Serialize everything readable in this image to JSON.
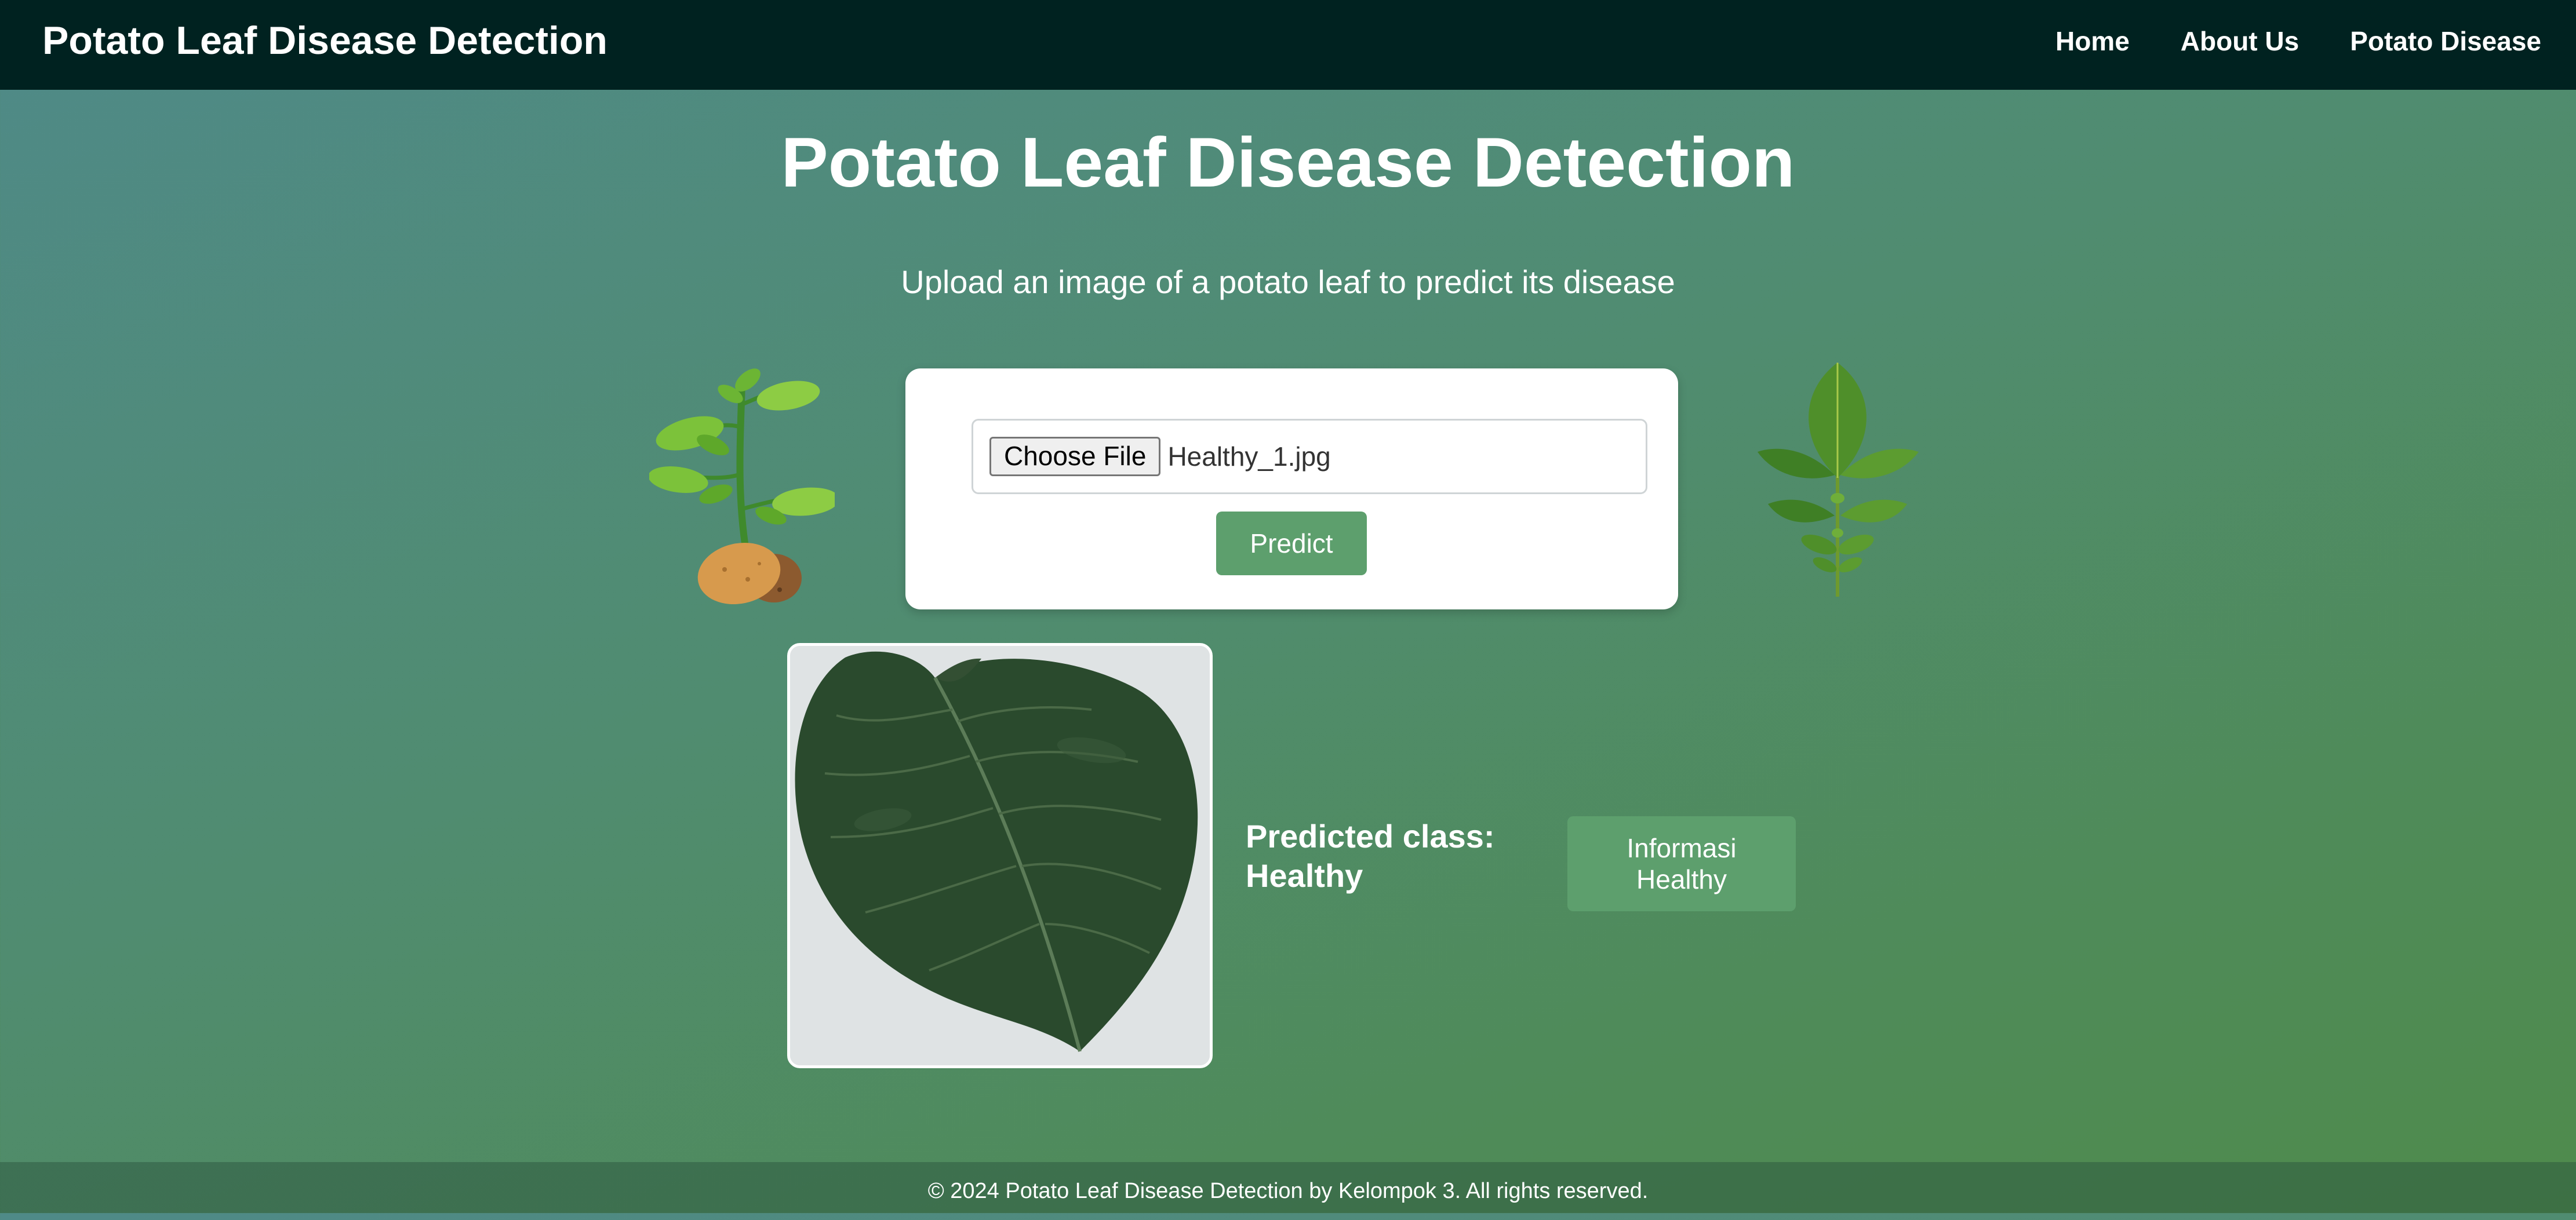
{
  "navbar": {
    "brand": "Potato Leaf Disease Detection",
    "links": [
      "Home",
      "About Us",
      "Potato Disease"
    ]
  },
  "main": {
    "title": "Potato Leaf Disease Detection",
    "subtitle": "Upload an image of a potato leaf to predict its disease"
  },
  "upload": {
    "choose_file_label": "Choose File",
    "file_name": "Healthy_1.jpg",
    "predict_label": "Predict"
  },
  "result": {
    "predicted_text": "Predicted class: Healthy",
    "info_button_label": "Informasi Healthy"
  },
  "footer": {
    "text": "© 2024 Potato Leaf Disease Detection by Kelompok 3. All rights reserved."
  },
  "icons": {
    "left_decoration": "potato-plant-icon",
    "right_decoration": "leaf-sprig-icon"
  },
  "colors": {
    "navbar_bg": "#002220",
    "accent_button": "#5d9f6d",
    "page_gradient_start": "#4f8a88",
    "page_gradient_end": "#4f8b4c"
  }
}
